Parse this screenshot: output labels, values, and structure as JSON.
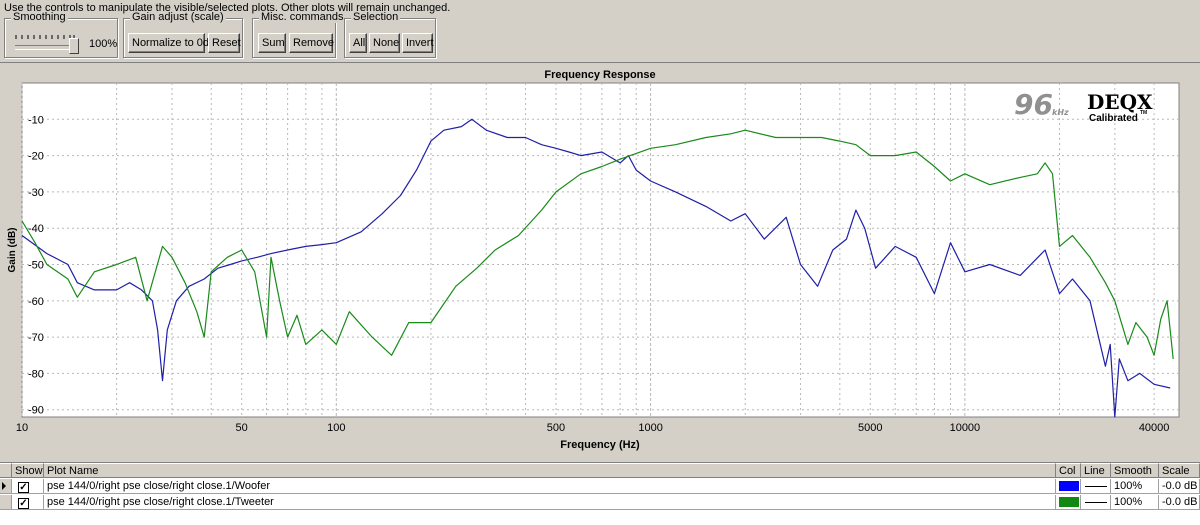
{
  "hint": "Use the controls to manipulate the visible/selected plots.  Other plots will remain unchanged.",
  "groups": {
    "smoothing": {
      "title": "Smoothing",
      "value": "100%",
      "level_percent": 100
    },
    "gain": {
      "title": "Gain adjust (scale)",
      "normalize": "Normalize to 0dB",
      "reset": "Reset"
    },
    "misc": {
      "title": "Misc. commands",
      "sum": "Sum",
      "remove": "Remove"
    },
    "selection": {
      "title": "Selection",
      "all": "All",
      "none": "None",
      "invert": "Invert"
    }
  },
  "logo": {
    "number": "96",
    "unit": "kHz",
    "brand": "DEQX",
    "sub": "Calibrated",
    "tm": "TM"
  },
  "colors": {
    "woofer": "#1f1fa8",
    "tweeter": "#1a8a1a",
    "woofer_swatch": "#0000ff",
    "tweeter_swatch": "#118811"
  },
  "chart_data": {
    "type": "line",
    "title": "Frequency Response",
    "xlabel": "Frequency (Hz)",
    "ylabel": "Gain (dB)",
    "xscale": "log",
    "xlim": [
      10,
      48000
    ],
    "ylim": [
      -92,
      0
    ],
    "xticks": [
      10,
      50,
      100,
      500,
      1000,
      5000,
      10000,
      40000
    ],
    "yticks": [
      -10,
      -20,
      -30,
      -40,
      -50,
      -60,
      -70,
      -80,
      -90
    ],
    "grid": true,
    "series": [
      {
        "name": "Woofer",
        "points": [
          [
            10,
            -42
          ],
          [
            12,
            -47
          ],
          [
            14,
            -50
          ],
          [
            15,
            -55
          ],
          [
            17,
            -57
          ],
          [
            20,
            -57
          ],
          [
            22,
            -55
          ],
          [
            24,
            -57
          ],
          [
            26,
            -60
          ],
          [
            27,
            -68
          ],
          [
            28,
            -82
          ],
          [
            29,
            -68
          ],
          [
            31,
            -60
          ],
          [
            34,
            -56
          ],
          [
            38,
            -54
          ],
          [
            42,
            -51
          ],
          [
            46,
            -50
          ],
          [
            50,
            -49
          ],
          [
            56,
            -48
          ],
          [
            62,
            -47
          ],
          [
            70,
            -46
          ],
          [
            80,
            -45
          ],
          [
            90,
            -44.5
          ],
          [
            100,
            -44
          ],
          [
            120,
            -41
          ],
          [
            140,
            -36
          ],
          [
            160,
            -31
          ],
          [
            180,
            -24
          ],
          [
            200,
            -16
          ],
          [
            220,
            -13
          ],
          [
            250,
            -12
          ],
          [
            270,
            -10
          ],
          [
            300,
            -13
          ],
          [
            350,
            -15
          ],
          [
            400,
            -15
          ],
          [
            450,
            -17
          ],
          [
            500,
            -18
          ],
          [
            550,
            -19
          ],
          [
            600,
            -20
          ],
          [
            700,
            -19
          ],
          [
            800,
            -22
          ],
          [
            850,
            -20
          ],
          [
            900,
            -24
          ],
          [
            1000,
            -27
          ],
          [
            1200,
            -30
          ],
          [
            1500,
            -34
          ],
          [
            1800,
            -38
          ],
          [
            2000,
            -36
          ],
          [
            2300,
            -43
          ],
          [
            2700,
            -37
          ],
          [
            3000,
            -50
          ],
          [
            3400,
            -56
          ],
          [
            3800,
            -46
          ],
          [
            4200,
            -43
          ],
          [
            4500,
            -35
          ],
          [
            4800,
            -40
          ],
          [
            5200,
            -51
          ],
          [
            6000,
            -45
          ],
          [
            7000,
            -48
          ],
          [
            8000,
            -58
          ],
          [
            9000,
            -44
          ],
          [
            10000,
            -52
          ],
          [
            12000,
            -50
          ],
          [
            15000,
            -53
          ],
          [
            18000,
            -46
          ],
          [
            20000,
            -58
          ],
          [
            22000,
            -54
          ],
          [
            25000,
            -60
          ],
          [
            28000,
            -78
          ],
          [
            29000,
            -72
          ],
          [
            30000,
            -92
          ],
          [
            31000,
            -76
          ],
          [
            33000,
            -82
          ],
          [
            36000,
            -80
          ],
          [
            40000,
            -83
          ],
          [
            45000,
            -84
          ]
        ]
      },
      {
        "name": "Tweeter",
        "points": [
          [
            10,
            -38
          ],
          [
            11,
            -44
          ],
          [
            12,
            -50
          ],
          [
            14,
            -54
          ],
          [
            15,
            -59
          ],
          [
            17,
            -52
          ],
          [
            20,
            -50
          ],
          [
            23,
            -48
          ],
          [
            25,
            -60
          ],
          [
            28,
            -45
          ],
          [
            30,
            -48
          ],
          [
            33,
            -55
          ],
          [
            36,
            -63
          ],
          [
            38,
            -70
          ],
          [
            40,
            -52
          ],
          [
            45,
            -48
          ],
          [
            50,
            -46
          ],
          [
            55,
            -52
          ],
          [
            60,
            -70
          ],
          [
            62,
            -48
          ],
          [
            66,
            -60
          ],
          [
            70,
            -70
          ],
          [
            75,
            -64
          ],
          [
            80,
            -72
          ],
          [
            90,
            -68
          ],
          [
            100,
            -72
          ],
          [
            110,
            -63
          ],
          [
            130,
            -70
          ],
          [
            150,
            -75
          ],
          [
            170,
            -66
          ],
          [
            200,
            -66
          ],
          [
            240,
            -56
          ],
          [
            280,
            -51
          ],
          [
            320,
            -46
          ],
          [
            380,
            -42
          ],
          [
            450,
            -35
          ],
          [
            500,
            -30
          ],
          [
            600,
            -25
          ],
          [
            700,
            -23
          ],
          [
            800,
            -21
          ],
          [
            1000,
            -18
          ],
          [
            1200,
            -17
          ],
          [
            1500,
            -15
          ],
          [
            1800,
            -14
          ],
          [
            2000,
            -13
          ],
          [
            2500,
            -15
          ],
          [
            3000,
            -15
          ],
          [
            3500,
            -15
          ],
          [
            4000,
            -16
          ],
          [
            4500,
            -17
          ],
          [
            5000,
            -20
          ],
          [
            6000,
            -20
          ],
          [
            7000,
            -19
          ],
          [
            8000,
            -23
          ],
          [
            9000,
            -27
          ],
          [
            10000,
            -25
          ],
          [
            12000,
            -28
          ],
          [
            15000,
            -26
          ],
          [
            17000,
            -25
          ],
          [
            18000,
            -22
          ],
          [
            19000,
            -25
          ],
          [
            20000,
            -45
          ],
          [
            22000,
            -42
          ],
          [
            25000,
            -48
          ],
          [
            28000,
            -55
          ],
          [
            30000,
            -60
          ],
          [
            33000,
            -72
          ],
          [
            35000,
            -66
          ],
          [
            38000,
            -70
          ],
          [
            40000,
            -75
          ],
          [
            42000,
            -65
          ],
          [
            44000,
            -60
          ],
          [
            46000,
            -76
          ]
        ]
      }
    ]
  },
  "table": {
    "headers": {
      "show": "Show",
      "name": "Plot Name",
      "col": "Col",
      "line": "Line",
      "smooth": "Smooth",
      "scale": "Scale"
    },
    "rows": [
      {
        "name": "pse 144/0/right pse close/right close.1/Woofer",
        "smooth": "100%",
        "scale": "-0.0 dB",
        "check": "✓"
      },
      {
        "name": "pse 144/0/right pse close/right close.1/Tweeter",
        "smooth": "100%",
        "scale": "-0.0 dB",
        "check": "✓"
      }
    ]
  }
}
